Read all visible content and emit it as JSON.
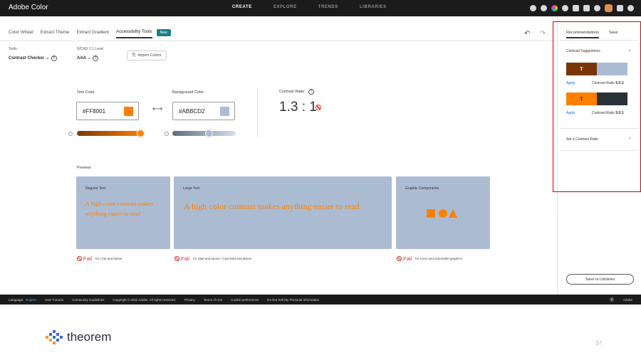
{
  "app": {
    "title": "Adobe Color"
  },
  "topnav": [
    {
      "label": "CREATE",
      "active": true
    },
    {
      "label": "EXPLORE",
      "active": false
    },
    {
      "label": "TRENDS",
      "active": false
    },
    {
      "label": "LIBRARIES",
      "active": false
    }
  ],
  "tabs": {
    "items": [
      "Color Wheel",
      "Extract Theme",
      "Extract Gradient",
      "Accessibility Tools"
    ],
    "active": "Accessibility Tools",
    "new_badge": "New"
  },
  "tools": {
    "label": "Tools",
    "value": "Contrast Checker"
  },
  "wcag": {
    "label": "WCAG 2.1 Level",
    "value": "AAA"
  },
  "import_label": "Import Colors",
  "text_color": {
    "label": "Text Color",
    "hex": "#FF8001",
    "swatch": "#ff8001"
  },
  "background_color": {
    "label": "Background Color",
    "hex": "#ABBCD2",
    "swatch": "#abbcd2"
  },
  "contrast": {
    "label": "Contrast Ratio",
    "value": "1.3 : 1"
  },
  "preview": {
    "label": "Preview",
    "cards": [
      {
        "label": "Regular Text",
        "text": "A high color contrast makes anything easier to read",
        "fail": "Fail",
        "note": "for 17pt and below"
      },
      {
        "label": "Large Text",
        "text": "A high color contrast makes anything easier to read",
        "fail": "Fail",
        "note": "for 18pt and above / 14pt bold and above"
      },
      {
        "label": "Graphic Components",
        "text": "",
        "fail": "Fail",
        "note": "for icons and actionable graphics"
      }
    ]
  },
  "right_panel": {
    "tabs": [
      "Recommendations",
      "Save"
    ],
    "section": "Contrast Suggestions",
    "suggestions": [
      {
        "letter": "T",
        "fg": "#7a3507",
        "bg": "#abbcd2",
        "apply": "Apply",
        "ratio_label": "Contrast Ratio",
        "ratio": "5.0:1"
      },
      {
        "letter": "T",
        "fg": "#ff8001",
        "bg": "#2b3138",
        "apply": "Apply",
        "ratio_label": "Contrast Ratio",
        "ratio": "5.0:1",
        "letter_color": "#222222"
      }
    ],
    "set_ratio": "Set a Contrast Ratio",
    "save_libraries": "Save to Libraries"
  },
  "footer": {
    "language_label": "Language:",
    "language": "English",
    "links": [
      "User Forums",
      "Community Guidelines",
      "Copyright © 2022 Adobe. All rights reserved.",
      "Privacy",
      "Terms of Use",
      "Cookie preferences",
      "Do Not Sell My Personal Information"
    ],
    "brand": "Adobe"
  },
  "slide": {
    "logo_text": "theorem",
    "page": "37"
  }
}
